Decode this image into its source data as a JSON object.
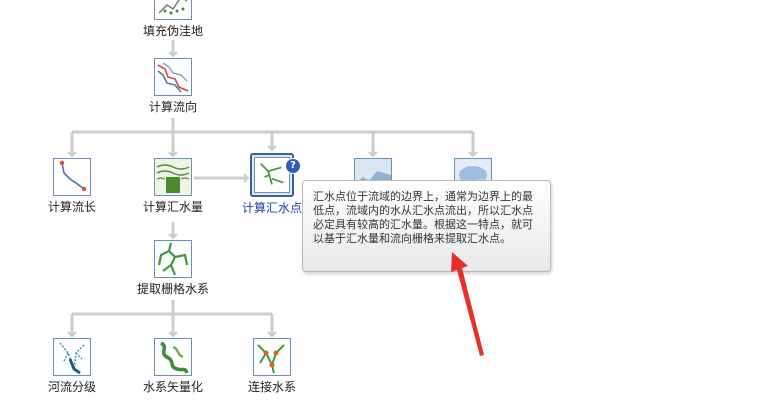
{
  "nodes": {
    "fill_sinks": {
      "label": "填充伪洼地"
    },
    "flow_direction": {
      "label": "计算流向"
    },
    "flow_length": {
      "label": "计算流长"
    },
    "flow_accumulation": {
      "label": "计算汇水量"
    },
    "pour_points": {
      "label": "计算汇水点"
    },
    "extract_stream_raster": {
      "label": "提取栅格水系"
    },
    "stream_order": {
      "label": "河流分级"
    },
    "stream_to_vector": {
      "label": "水系矢量化"
    },
    "stream_link": {
      "label": "连接水系"
    }
  },
  "help_badge": "?",
  "tooltip": {
    "text": "汇水点位于流域的边界上，通常为边界上的最低点，流域内的水从汇水点流出，所以汇水点必定具有较高的汇水量。根据这一特点，就可以基于汇水量和流向栅格来提取汇水点。"
  },
  "colors": {
    "connector": "#cccccc",
    "icon_border": "#6d8fb8",
    "selected_label": "#1f3faa",
    "annotation_arrow": "#e8302a"
  },
  "icons": {
    "fill_sinks": "scatter-dots-icon",
    "flow_direction": "flow-direction-icon",
    "flow_length": "flow-length-icon",
    "flow_accumulation": "flow-accumulation-icon",
    "pour_points": "pour-points-icon",
    "extract_stream_raster": "stream-network-icon",
    "stream_order": "stream-order-icon",
    "stream_to_vector": "stream-vector-icon",
    "stream_link": "stream-link-icon"
  }
}
